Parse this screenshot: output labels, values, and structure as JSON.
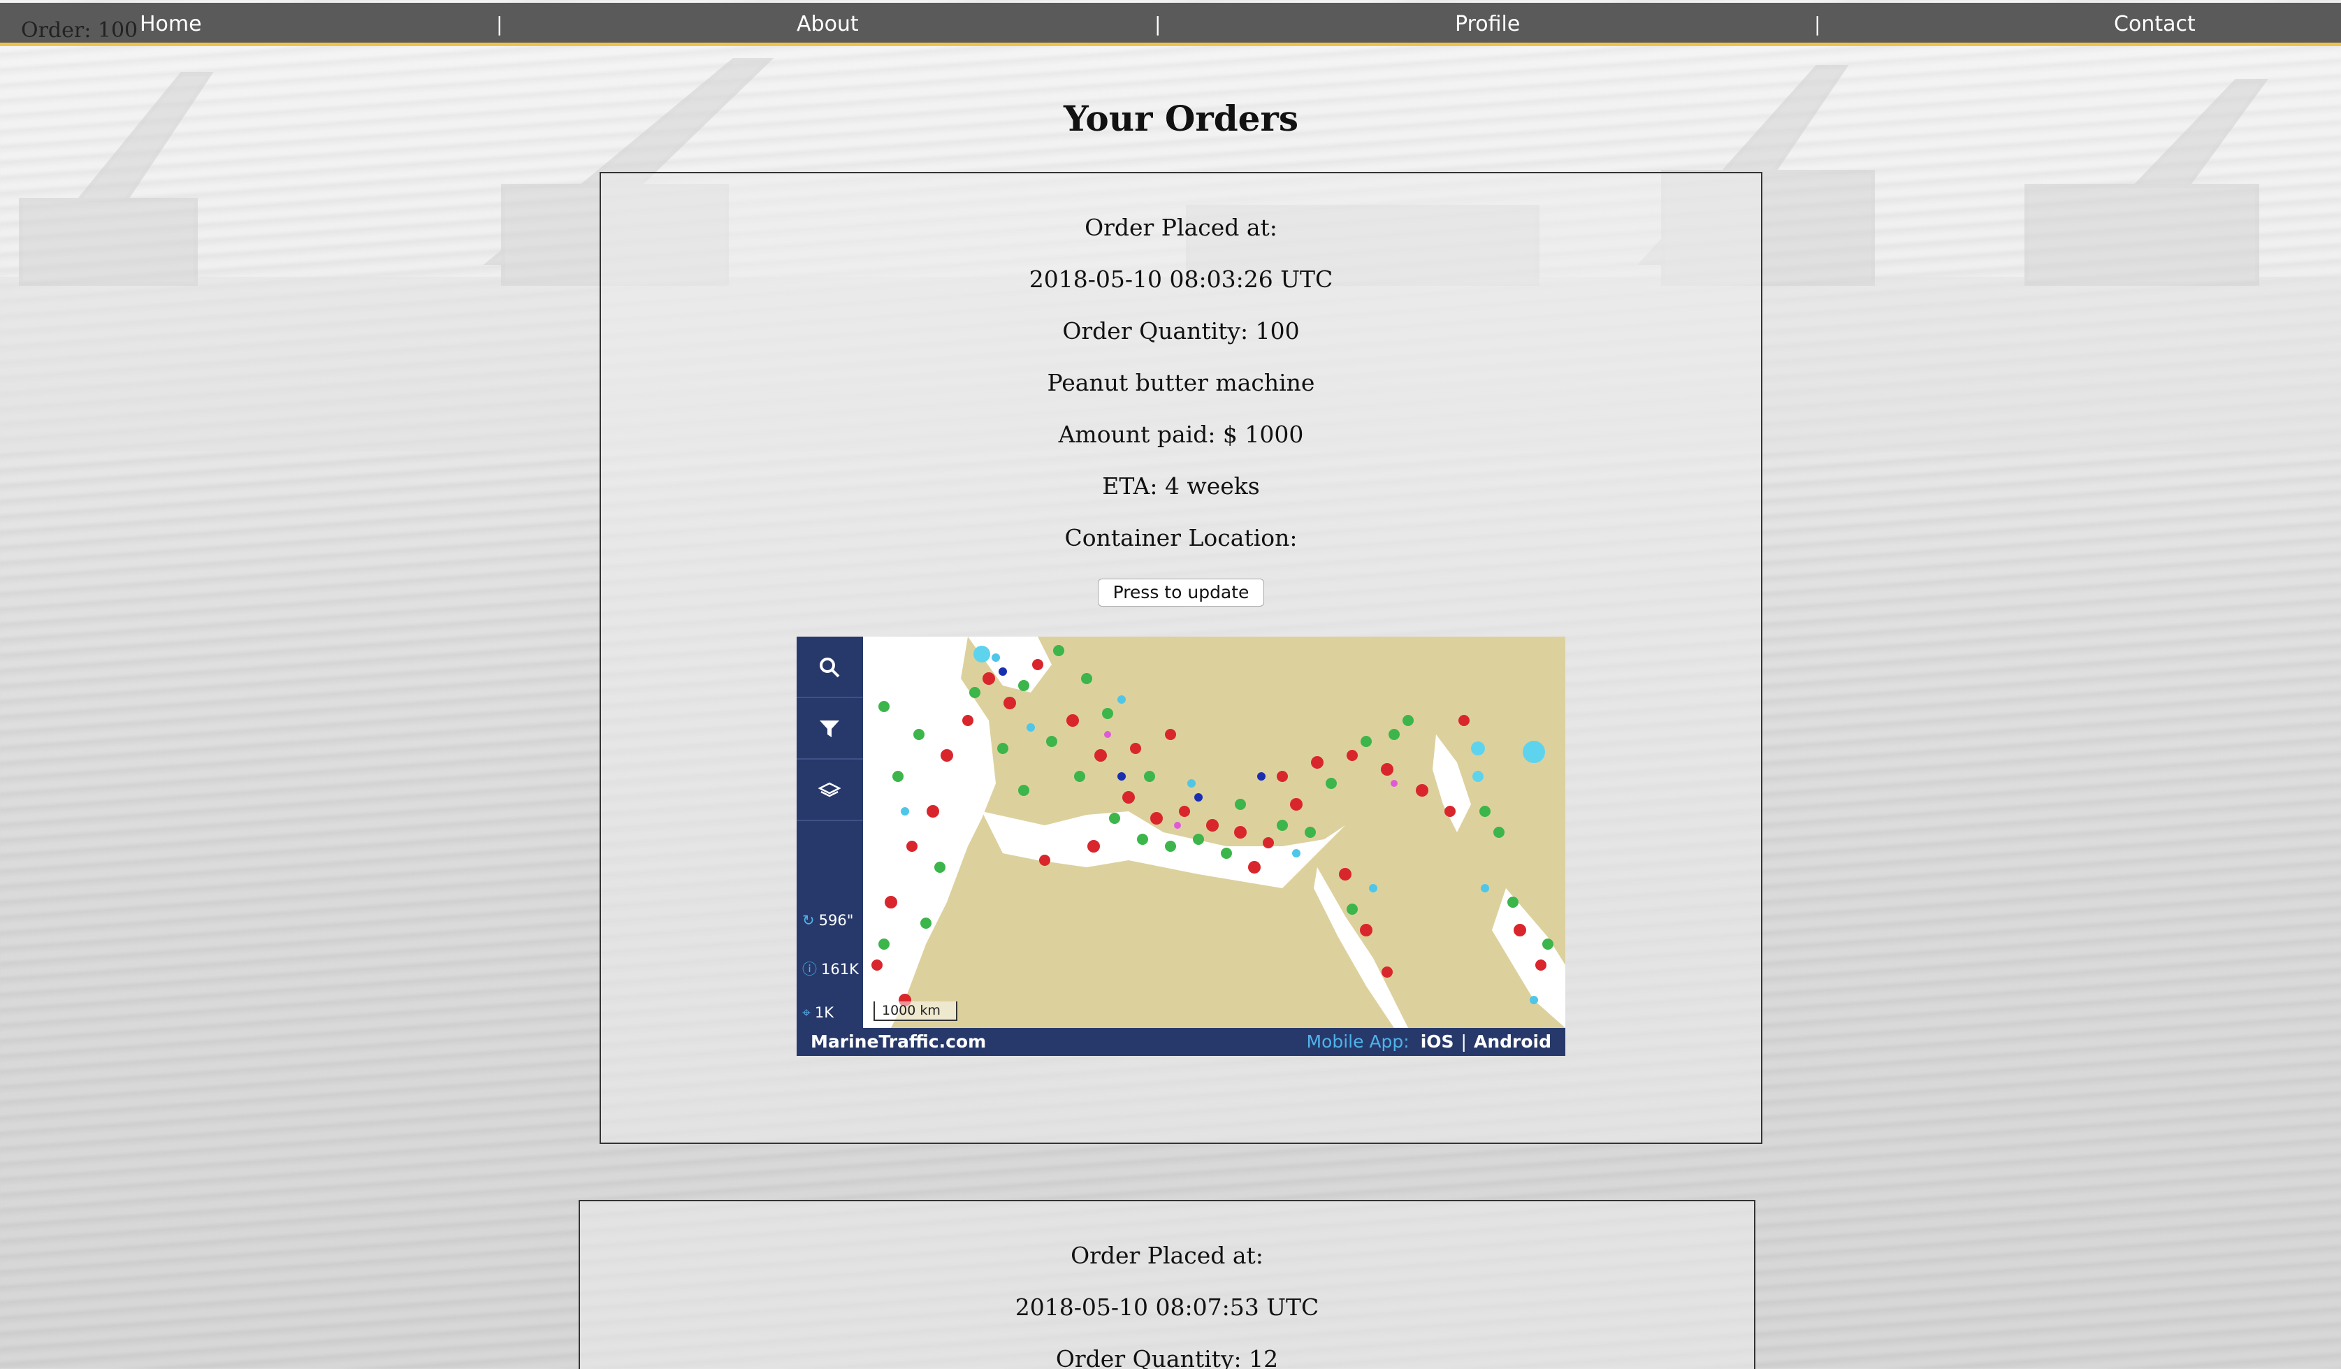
{
  "header": {
    "order_count": "Order: 100",
    "nav": [
      "Home",
      "About",
      "Profile",
      "Contact"
    ],
    "separator": "|"
  },
  "page": {
    "title": "Your Orders"
  },
  "orders": [
    {
      "placed_label": "Order Placed at:",
      "placed_at": "2018-05-10 08:03:26 UTC",
      "quantity": "Order Quantity: 100",
      "product": "Peanut butter machine",
      "amount": "Amount paid: $ 1000",
      "eta": "ETA: 4 weeks",
      "location_label": "Container Location:",
      "update_button": "Press to update",
      "map": {
        "tools": [
          "search-icon",
          "filter-icon",
          "layers-icon"
        ],
        "stats": {
          "refresh": "596\"",
          "vessels": "161K",
          "gps": "1K"
        },
        "scale": "1000 km",
        "brand": "MarineTraffic.com",
        "mobile_label": "Mobile App:",
        "ios": "iOS",
        "android": "Android",
        "app_separator": "|",
        "colors": {
          "sea_panel": "#27396b",
          "land": "#dcd19d",
          "accent": "#4fb3ea"
        }
      }
    },
    {
      "placed_label": "Order Placed at:",
      "placed_at": "2018-05-10 08:07:53 UTC",
      "quantity": "Order Quantity: 12"
    }
  ],
  "colors": {
    "navbar": "#5a5a5a",
    "navbar_border": "#f1c24a"
  }
}
